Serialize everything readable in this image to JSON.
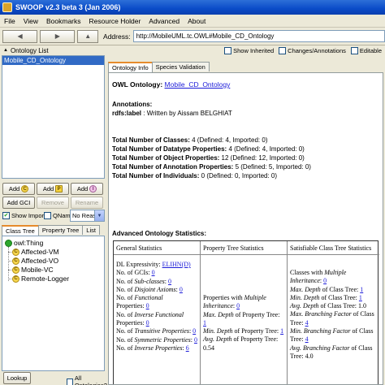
{
  "window": {
    "title": "SWOOP v2.3 beta 3 (Jan 2006)"
  },
  "menu": [
    "File",
    "View",
    "Bookmarks",
    "Resource Holder",
    "Advanced",
    "About"
  ],
  "toolbar": {
    "back": "◀",
    "forward": "▶",
    "home": "▲",
    "address_label": "Address:",
    "address_value": "http://MobileUML.tc.OWL#Mobile_CD_Ontology"
  },
  "left_panel": {
    "ontology_list_header": "Ontology List",
    "ontologies": [
      "Mobile_CD_Ontology"
    ],
    "buttons": {
      "add_c": "Add",
      "add_p": "Add",
      "add_i": "Add",
      "add_gci": "Add GCI",
      "remove": "Remove",
      "rename": "Rename"
    },
    "badge_c": "C",
    "badge_p": "P",
    "badge_i": "I",
    "show_imports": "Show Imports",
    "qnames": "QNames",
    "reasoner_select": "No Reas...",
    "tabs": [
      "Class Tree",
      "Property Tree",
      "List"
    ],
    "tree": {
      "root": "owl:Thing",
      "children": [
        "Affected-VM",
        "Affected-VO",
        "Mobile-VC",
        "Remote-Logger"
      ]
    },
    "lookup_button": "Lookup",
    "all_ontologies": "All Ontologies?"
  },
  "right_panel": {
    "options": {
      "show_inherited": "Show Inherited",
      "changes_annotations": "Changes/Annotations",
      "editable": "Editable"
    },
    "tabs": [
      "Ontology Info",
      "Species Validation"
    ],
    "content": {
      "owl_ontology_label": "OWL Ontology:",
      "owl_ontology_link": "Mobile_CD_Ontology",
      "annotations_label": "Annotations:",
      "rdfs_label": "rdfs:label",
      "rdfs_value": ": Written by Aissam BELGHIAT",
      "counts": [
        {
          "label": "Total Number of Classes:",
          "value": "4 (Defined: 4, Imported: 0)"
        },
        {
          "label": "Total Number of Datatype Properties:",
          "value": "4 (Defined: 4, Imported: 0)"
        },
        {
          "label": "Total Number of Object Properties:",
          "value": "12 (Defined: 12, Imported: 0)"
        },
        {
          "label": "Total Number of Annotation Properties:",
          "value": "5 (Defined: 5, Imported: 0)"
        },
        {
          "label": "Total Number of Individuals:",
          "value": "0 (Defined: 0, Imported: 0)"
        }
      ],
      "advanced_label": "Advanced Ontology Statistics:",
      "table": {
        "headers": [
          "General Statistics",
          "Property Tree Statistics",
          "Satisfiable Class Tree Statistics"
        ],
        "general": {
          "dl_label": "DL Expressivity:",
          "dl_value": "ELIHN(D)",
          "gcis": "No. of GCIs: ",
          "gcis_val": "0",
          "subclasses_pre": "No. of ",
          "subclasses_it": "Sub-classes",
          "subclasses_post": ": ",
          "subclasses_val": "0",
          "disjoint_pre": "No. of ",
          "disjoint_it": "Disjoint Axioms",
          "disjoint_post": ": ",
          "disjoint_val": "0",
          "functional_pre": "No. of ",
          "functional_it": "Functional",
          "functional_post": "Properties: ",
          "functional_val": "0",
          "invfunc_pre": "No. of ",
          "invfunc_it": "Inverse Functional",
          "invfunc_post": "Properties: ",
          "invfunc_val": "0",
          "transitive_pre": "No. of ",
          "transitive_it": "Transitive Properties",
          "transitive_post": ": ",
          "transitive_val": "0",
          "symmetric_pre": "No. of ",
          "symmetric_it": "Symmetric Properties",
          "symmetric_post": ": ",
          "symmetric_val": "0",
          "inverse_pre": "No. of ",
          "inverse_it": "Inverse Properties",
          "inverse_post": ": ",
          "inverse_val": "6"
        },
        "property": {
          "multi_pre": "Properties with ",
          "multi_it": "Multiple",
          "multi_it2": "Inheritance",
          "multi_post": ": ",
          "multi_val": "0",
          "maxd_it": "Max.  Depth",
          "maxd_post": " of Property Tree: ",
          "maxd_val": "1",
          "mind_it": "Min.  Depth",
          "mind_post": " of Property Tree: ",
          "mind_val": "1",
          "avgd_it": "Avg.  Depth",
          "avgd_post": " of Property Tree: ",
          "avgd_val": "0.54"
        },
        "class_tree": {
          "multi_pre": "Classes with ",
          "multi_it": "Multiple Inheritance",
          "multi_post": ": ",
          "multi_val": "0",
          "maxd_it": "Max.  Depth",
          "maxd_post": " of Class Tree: ",
          "maxd_val": "1",
          "mind_it": "Min.  Depth",
          "mind_post": " of Class Tree: ",
          "mind_val": "1",
          "avgd_it": "Avg.  Depth",
          "avgd_post": " of Class Tree: ",
          "avgd_val": "1.0",
          "maxb_it": "Max.  Branching Factor",
          "maxb_post": " of Class",
          "maxb_line2": "Tree: ",
          "maxb_val": "4",
          "minb_it": "Min.  Branching Factor",
          "minb_post": " of Class",
          "minb_line2": "Tree: ",
          "minb_val": "4",
          "avgb_it": "Avg.  Branching Factor",
          "avgb_post": " of Class",
          "avgb_line2": "Tree: ",
          "avgb_val": "4.0"
        }
      }
    }
  }
}
